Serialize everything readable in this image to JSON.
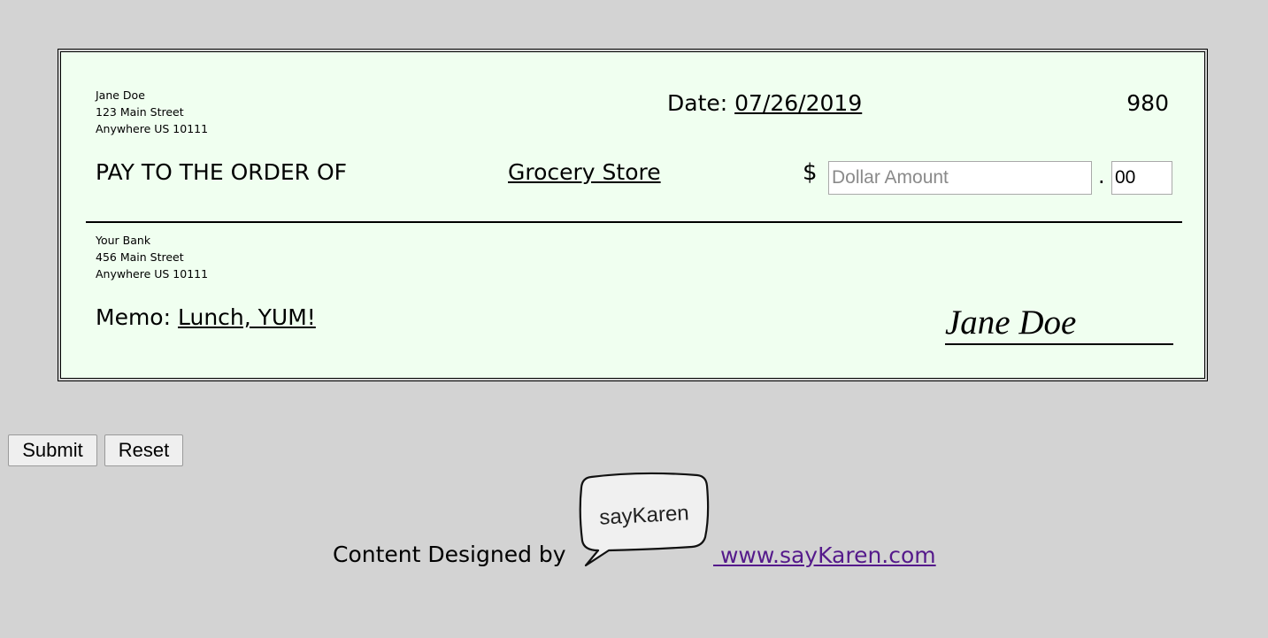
{
  "check": {
    "payer": {
      "name": "Jane Doe",
      "street": "123 Main Street",
      "city": "Anywhere US 10111"
    },
    "date_label": "Date:",
    "date_value": "07/26/2019",
    "check_number": "980",
    "pay_to_label": "PAY TO THE ORDER OF",
    "payee": "Grocery Store",
    "dollar_sign": "$",
    "amount_placeholder": "Dollar Amount",
    "amount_value": "",
    "decimal_point": ".",
    "cents_value": "00",
    "bank": {
      "name": "Your Bank",
      "street": "456 Main Street",
      "city": "Anywhere US 10111"
    },
    "memo_label": "Memo:",
    "memo_value": "Lunch, YUM!",
    "signature": "Jane Doe"
  },
  "buttons": {
    "submit_label": "Submit",
    "reset_label": "Reset"
  },
  "footer": {
    "credit_label": "Content Designed by",
    "logo_text": "sayKaren",
    "link_text": " www.sayKaren.com"
  },
  "colors": {
    "page_background": "#d3d3d3",
    "check_background": "#f0fff0",
    "link": "#551a8b"
  }
}
